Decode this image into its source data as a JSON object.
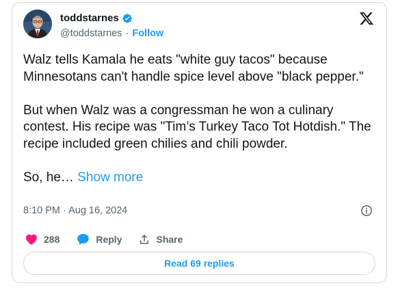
{
  "tweet": {
    "display_name": "toddstarnes",
    "handle": "@toddstarnes",
    "separator": "·",
    "follow_label": "Follow",
    "paragraphs": [
      "Walz tells Kamala he eats \"white guy tacos\" because Minnesotans can't handle spice level above \"black pepper.\"",
      "But when Walz was a congressman he won a culinary contest. His recipe was \"Tim’s Turkey Taco Tot Hotdish.\" The recipe included green chilies and chili powder."
    ],
    "truncated_text": "So, he…",
    "show_more_label": "Show more",
    "timestamp": "8:10 PM · Aug 16, 2024",
    "like_count": "288",
    "reply_label": "Reply",
    "share_label": "Share",
    "read_replies_label": "Read 69 replies"
  },
  "icons": {
    "verified": "verified-badge-icon",
    "platform_logo": "x-logo-icon",
    "info": "info-icon",
    "like": "heart-icon",
    "reply": "speech-bubble-icon",
    "share": "share-upload-icon"
  },
  "colors": {
    "accent": "#1d9bf0",
    "like": "#f91880",
    "text": "#0f1419",
    "secondary": "#536471",
    "border": "#cfd9de"
  }
}
